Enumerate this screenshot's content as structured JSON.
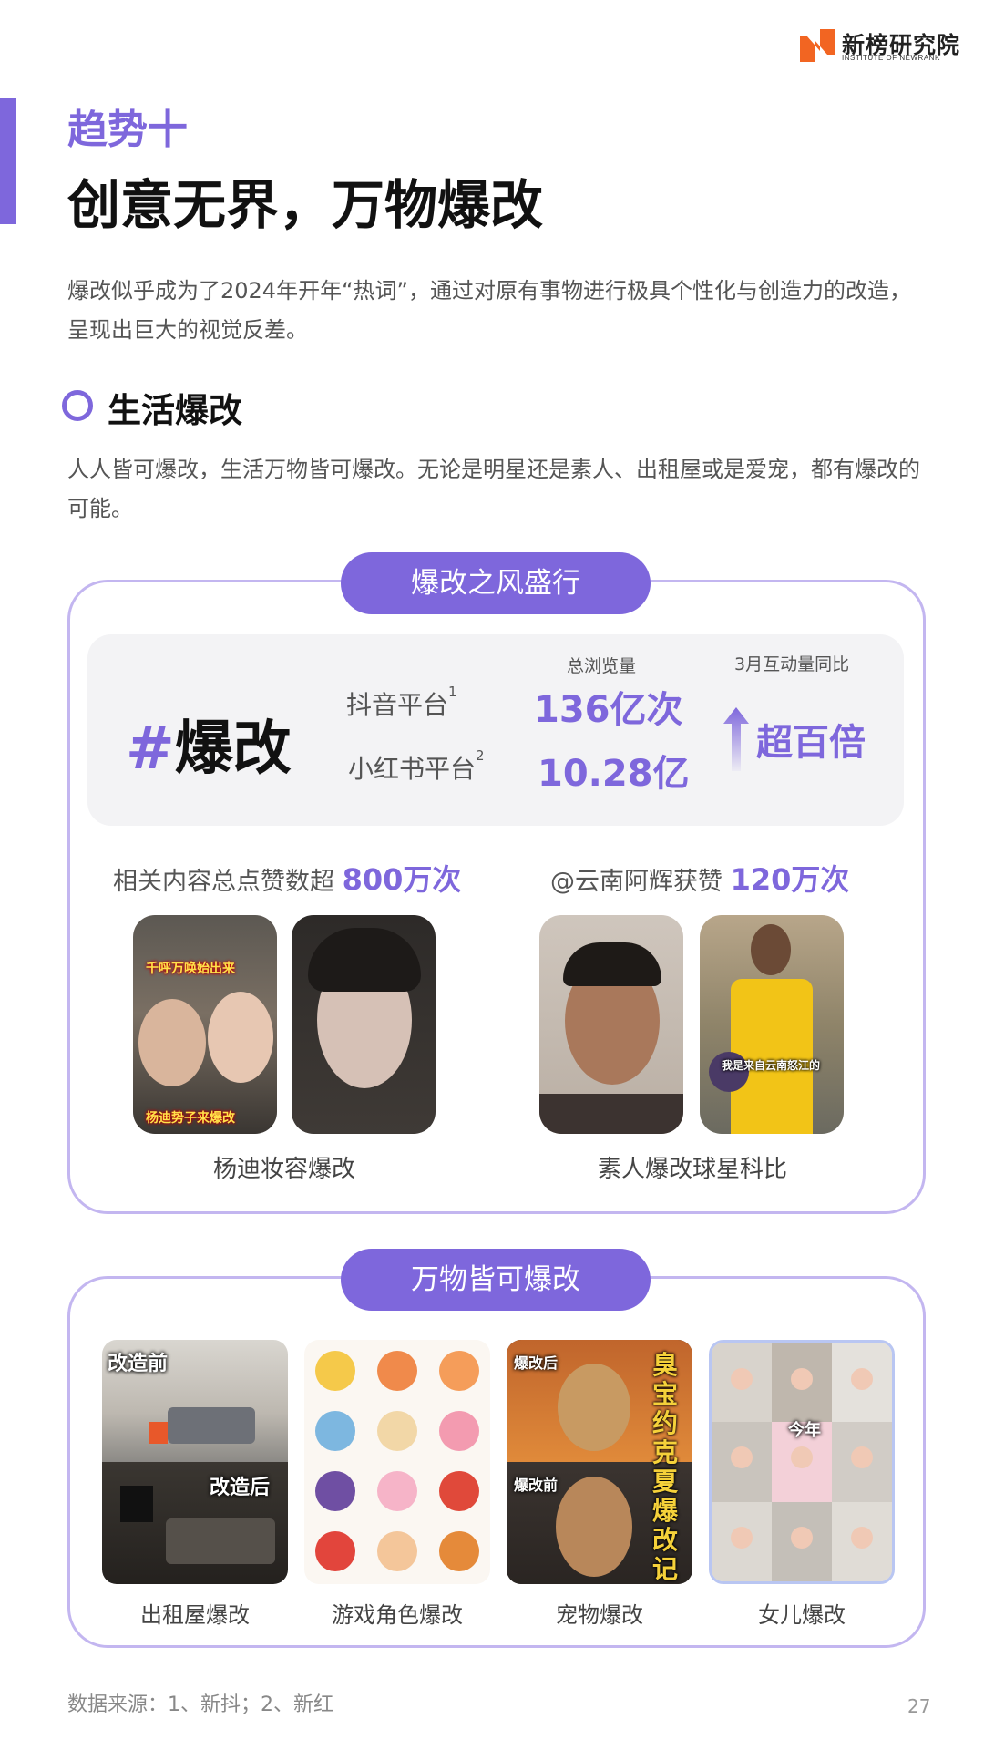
{
  "header": {
    "logo_cn": "新榜研究院",
    "logo_en": "INSTITUTE OF NEWRANK",
    "trend_label": "趋势十",
    "title": "创意无界，万物爆改"
  },
  "intro": "爆改似乎成为了2024年开年“热词”，通过对原有事物进行极具个性化与创造力的改造，呈现出巨大的视觉反差。",
  "section": {
    "title": "生活爆改",
    "desc": "人人皆可爆改，生活万物皆可爆改。无论是明星还是素人、出租屋或是爱宠，都有爆改的可能。"
  },
  "panel1": {
    "pill": "爆改之风盛行",
    "hashtag_symbol": "#",
    "hashtag_text": "爆改",
    "views_header": "总浏览量",
    "growth_header": "3月互动量同比",
    "platforms": [
      {
        "name": "抖音平台",
        "note": "1",
        "views": "136亿次"
      },
      {
        "name": "小红书平台",
        "note": "2",
        "views": "10.28亿"
      }
    ],
    "growth_value": "超百倍",
    "likes_left_text": "相关内容总点赞数超",
    "likes_left_value": "800万次",
    "likes_right_text": "@云南阿辉获赞",
    "likes_right_value": "120万次",
    "photo1_top_text": "千呼万唤始出来",
    "photo1_bottom_text": "杨迪势子来爆改",
    "photo4_text": "我是来自云南怒江的",
    "caption_left": "杨迪妆容爆改",
    "caption_right": "素人爆改球星科比"
  },
  "panel2": {
    "pill": "万物皆可爆改",
    "room_before": "改造前",
    "room_after": "改造后",
    "pet_after": "爆改后",
    "pet_before": "爆改前",
    "pet_vertical": "臭宝约克夏爆改记",
    "daughter_label": "今年",
    "captions": [
      "出租屋爆改",
      "游戏角色爆改",
      "宠物爆改",
      "女儿爆改"
    ]
  },
  "footer": {
    "source": "数据来源：1、新抖；2、新红",
    "page": "27"
  },
  "colors": {
    "accent": "#7e67dc",
    "panel_border": "#c3b6f0",
    "stats_bg": "#f3f3f5",
    "logo_orange": "#f26522"
  }
}
